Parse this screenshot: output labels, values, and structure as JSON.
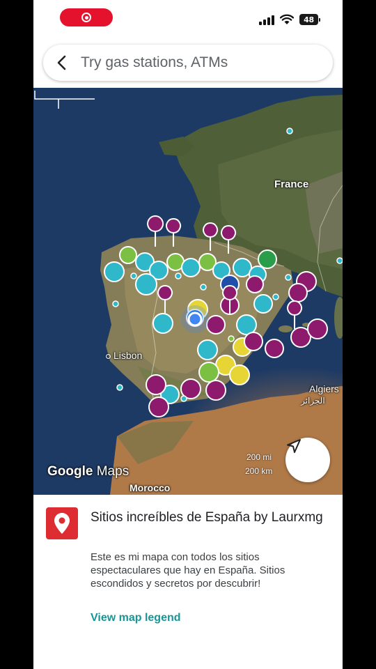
{
  "status_bar": {
    "battery": "48"
  },
  "search": {
    "placeholder": "Try gas stations, ATMs"
  },
  "map": {
    "labels": {
      "france": "France",
      "lisbon": "Lisbon",
      "algiers": "Algiers",
      "algiers_ar": "الجزائر",
      "morocco": "Morocco"
    },
    "logo": {
      "google": "Google",
      "maps": "Maps"
    },
    "scale": {
      "mi": "200 mi",
      "km": "200 km"
    }
  },
  "panel": {
    "title": "Sitios increíbles de España by Laurxmg",
    "description": "Este es mi mapa con todos los sitios espectaculares que hay en España. Sitios escondidos y secretos por descubrir!",
    "legend_link": "View map legend"
  },
  "colors": {
    "marker_purple": "#8e1a6e",
    "marker_cyan": "#2fb8c9",
    "marker_green": "#7bc043",
    "marker_yellow": "#e6d534",
    "map_pin_tile": "#de2d32",
    "link": "#1a9494"
  }
}
